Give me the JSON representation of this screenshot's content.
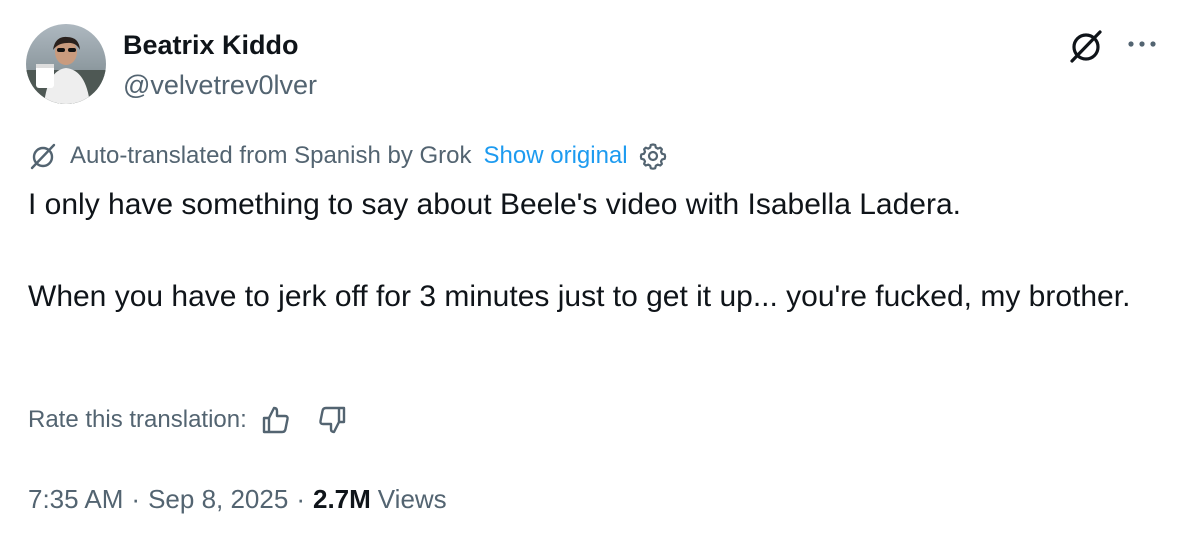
{
  "author": {
    "display_name": "Beatrix Kiddo",
    "handle": "@velvetrev0lver",
    "avatar_icon": "profile-photo"
  },
  "header_actions": {
    "grok_icon": "grok-icon",
    "more_icon": "more-horizontal-icon"
  },
  "translation": {
    "label": "Auto-translated from Spanish by Grok",
    "show_original": "Show original",
    "settings_icon": "gear-icon"
  },
  "tweet": {
    "paragraphs": [
      "I only have something to say about Beele's video with Isabella Ladera.",
      "When you have to jerk off for 3 minutes just to get it up... you're fucked, my brother."
    ]
  },
  "rating": {
    "label": "Rate this translation:",
    "thumbs_up_icon": "thumbs-up-icon",
    "thumbs_down_icon": "thumbs-down-icon"
  },
  "meta": {
    "time": "7:35 AM",
    "separator": "·",
    "date": "Sep 8, 2025",
    "views_count": "2.7M",
    "views_label": "Views"
  },
  "colors": {
    "text_primary": "#0f1419",
    "text_secondary": "#536471",
    "link": "#1d9bf0"
  }
}
